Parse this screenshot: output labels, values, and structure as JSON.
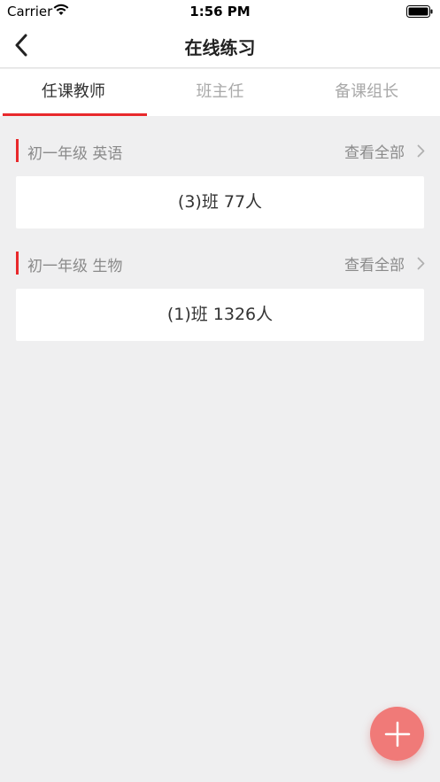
{
  "status_bar": {
    "carrier": "Carrier",
    "time": "1:56 PM"
  },
  "navbar": {
    "title": "在线练习"
  },
  "tabs": [
    {
      "label": "任课教师",
      "active": true
    },
    {
      "label": "班主任",
      "active": false
    },
    {
      "label": "备课组长",
      "active": false
    }
  ],
  "sections": [
    {
      "title": "初一年级 英语",
      "view_all": "查看全部",
      "class_card": "(3)班 77人"
    },
    {
      "title": "初一年级 生物",
      "view_all": "查看全部",
      "class_card": "(1)班 1326人"
    }
  ],
  "colors": {
    "accent": "#e8292c",
    "fab": "#f07a78",
    "background": "#efeff0"
  },
  "icons": {
    "back": "chevron-left-icon",
    "view_all": "chevron-right-icon",
    "fab": "plus-icon"
  }
}
